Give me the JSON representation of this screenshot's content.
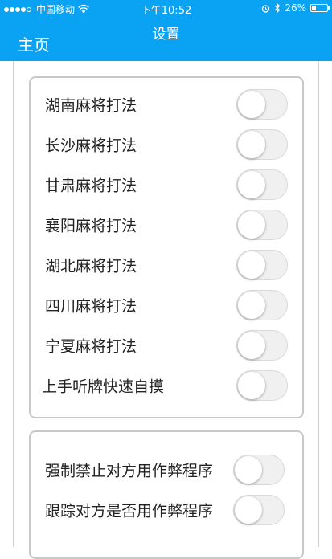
{
  "status_bar": {
    "carrier": "中国移动",
    "time": "下午10:52",
    "battery": "26%",
    "battery_level": 0.26,
    "signal_bars_filled": 4,
    "signal_bars_total": 5
  },
  "nav": {
    "title": "设置",
    "back_label": "主页"
  },
  "colors": {
    "accent": "#0aa2f3",
    "switch_off_track": "#f0f0f0",
    "group_border": "#c8c8c8"
  },
  "groups": [
    {
      "items": [
        {
          "label": "湖南麻将打法",
          "on": false
        },
        {
          "label": "长沙麻将打法",
          "on": false
        },
        {
          "label": "甘肃麻将打法",
          "on": false
        },
        {
          "label": "襄阳麻将打法",
          "on": false
        },
        {
          "label": "湖北麻将打法",
          "on": false
        },
        {
          "label": "四川麻将打法",
          "on": false
        },
        {
          "label": "宁夏麻将打法",
          "on": false
        },
        {
          "label": "上手听牌快速自摸",
          "on": false
        }
      ]
    },
    {
      "items": [
        {
          "label": "强制禁止对方用作弊程序",
          "on": false
        },
        {
          "label": "跟踪对方是否用作弊程序",
          "on": false
        }
      ]
    }
  ]
}
